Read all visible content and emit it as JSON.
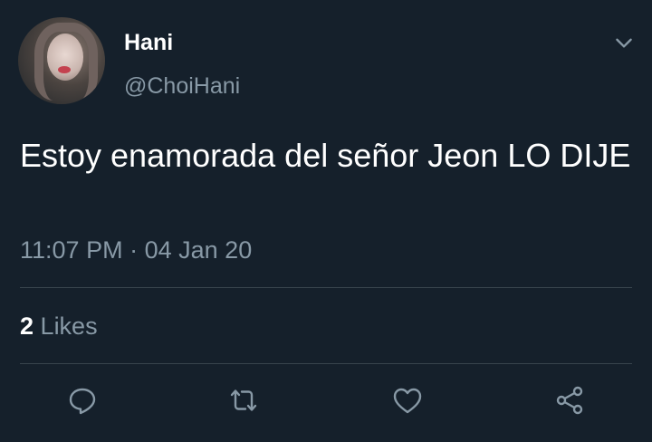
{
  "tweet": {
    "author_name": "Hani",
    "author_handle": "@ChoiHani",
    "text": "Estoy enamorada del señor Jeon LO DIJE",
    "time": "11:07 PM",
    "separator": "·",
    "date": "04 Jan 20",
    "likes_count": "2",
    "likes_label": "Likes"
  },
  "icons": {
    "menu": "chevron-down-icon",
    "reply": "reply-icon",
    "retweet": "retweet-icon",
    "like": "heart-icon",
    "share": "share-icon"
  },
  "colors": {
    "background": "#15202b",
    "primary_text": "#ffffff",
    "secondary_text": "#8899a6",
    "divider": "#38444d"
  }
}
